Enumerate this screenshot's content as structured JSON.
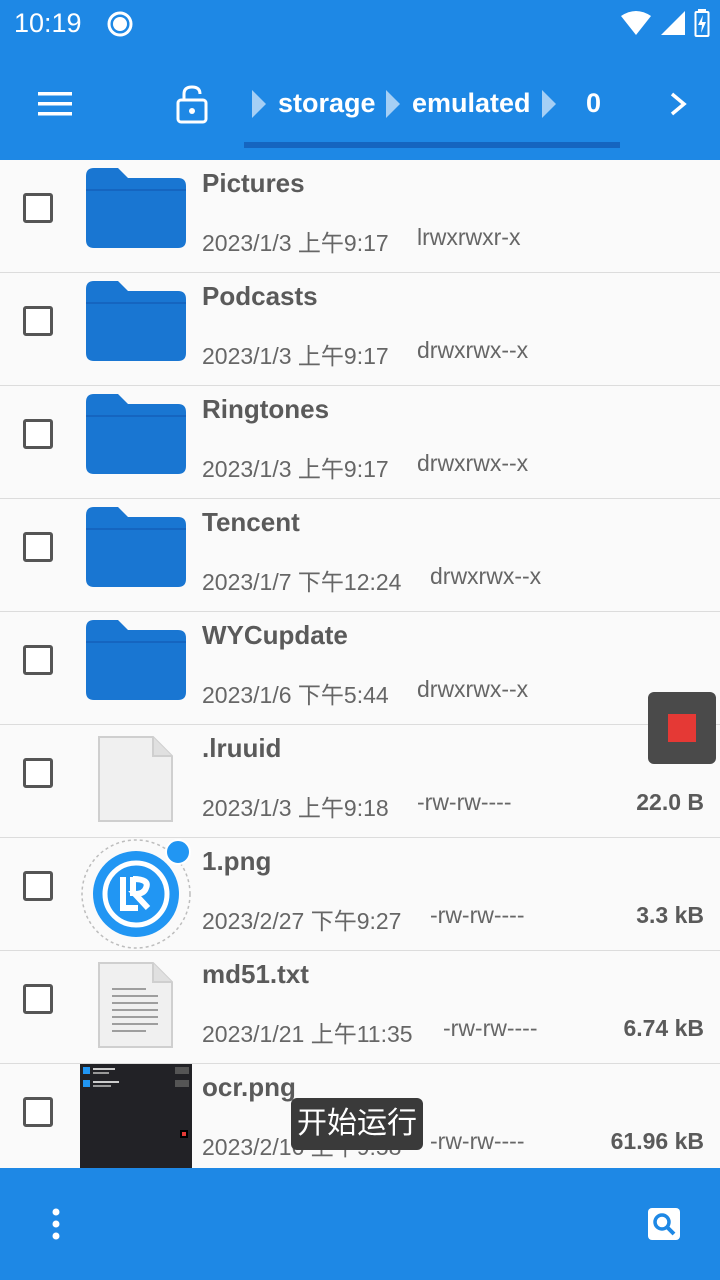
{
  "status_bar": {
    "time": "10:19",
    "icons": [
      "notification-ring-icon",
      "wifi-icon",
      "cell-signal-icon",
      "battery-charging-icon"
    ]
  },
  "app_bar": {
    "menu_icon": "menu-icon",
    "lock_icon": "lock-open-icon",
    "breadcrumbs": [
      "storage",
      "emulated",
      "0"
    ],
    "next_icon": "chevron-right-icon"
  },
  "files": [
    {
      "name": "Pictures",
      "date": "2023/1/3 上午9:17",
      "perm": "lrwxrwxr-x",
      "size": "",
      "type": "folder"
    },
    {
      "name": "Podcasts",
      "date": "2023/1/3 上午9:17",
      "perm": "drwxrwx--x",
      "size": "",
      "type": "folder"
    },
    {
      "name": "Ringtones",
      "date": "2023/1/3 上午9:17",
      "perm": "drwxrwx--x",
      "size": "",
      "type": "folder"
    },
    {
      "name": "Tencent",
      "date": "2023/1/7 下午12:24",
      "perm": "drwxrwx--x",
      "size": "",
      "type": "folder"
    },
    {
      "name": "WYCupdate",
      "date": "2023/1/6 下午5:44",
      "perm": "drwxrwx--x",
      "size": "",
      "type": "folder"
    },
    {
      "name": ".lruuid",
      "date": "2023/1/3 上午9:18",
      "perm": "-rw-rw----",
      "size": "22.0 B",
      "type": "blank-file"
    },
    {
      "name": "1.png",
      "date": "2023/2/27 下午9:27",
      "perm": "-rw-rw----",
      "size": "3.3 kB",
      "type": "image-lr"
    },
    {
      "name": "md51.txt",
      "date": "2023/1/21 上午11:35",
      "perm": "-rw-rw----",
      "size": "6.74 kB",
      "type": "text-file"
    },
    {
      "name": "ocr.png",
      "date": "2023/2/16 上午9:58",
      "perm": "-rw-rw----",
      "size": "61.96 kB",
      "type": "image-screenshot"
    }
  ],
  "bottom_bar": {
    "more_icon": "more-vertical-icon",
    "search_icon": "search-icon"
  },
  "floating": {
    "stop_icon": "stop-icon",
    "toast": "开始运行"
  },
  "colors": {
    "primary": "#1e88e5",
    "folder": "#1976d2",
    "stop": "#e53935"
  }
}
